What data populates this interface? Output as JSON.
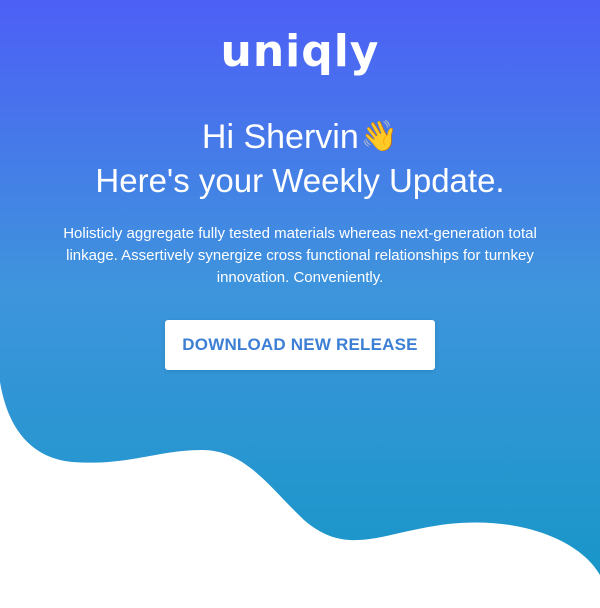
{
  "brand": {
    "logo_text": "uniqly"
  },
  "hero": {
    "greeting": "Hi Shervin",
    "greeting_emoji": "👋",
    "subtitle": "Here's your Weekly Update.",
    "body": "Holisticly aggregate fully tested materials whereas next-generation total linkage. Assertively synergize cross functional relationships for turnkey innovation. Conveniently.",
    "cta_label": "DOWNLOAD NEW RELEASE"
  },
  "colors": {
    "gradient_top": "#4d5ff6",
    "gradient_middle": "#3f93dc",
    "gradient_bottom": "#1596c7",
    "accent_text": "#3d7fd4",
    "white": "#ffffff"
  }
}
